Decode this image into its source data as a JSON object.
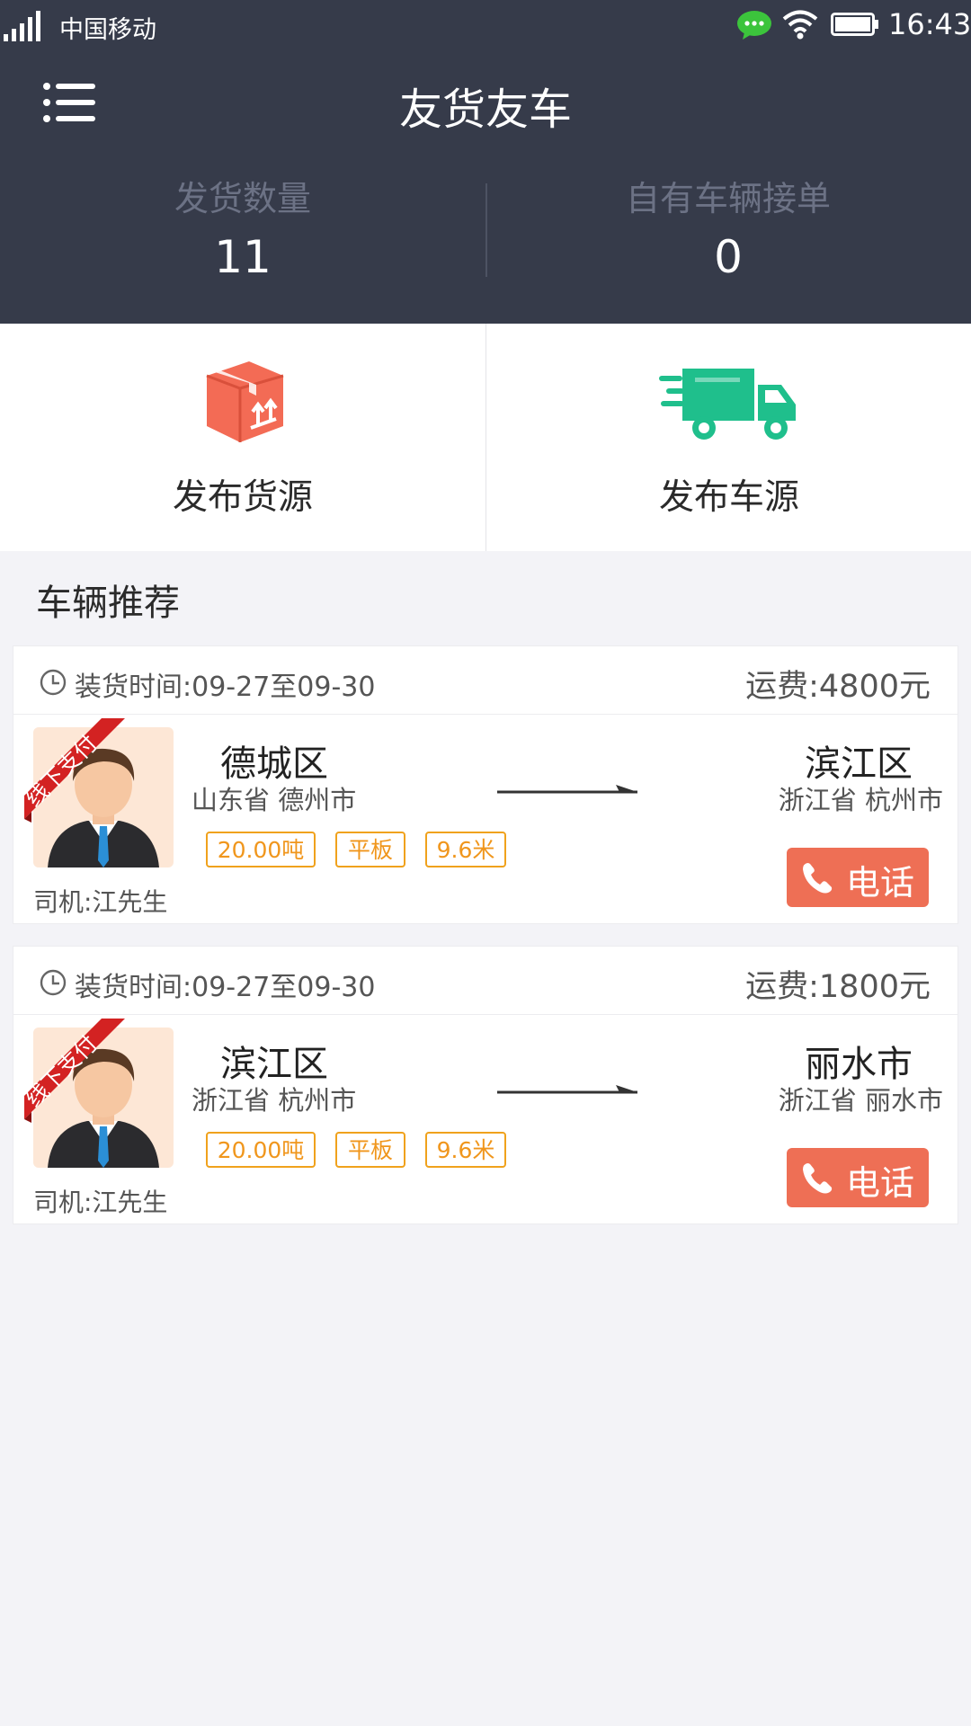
{
  "status_bar": {
    "carrier": "中国移动",
    "time": "16:43"
  },
  "header": {
    "title": "友货友车",
    "stats": [
      {
        "label": "发货数量",
        "value": "11"
      },
      {
        "label": "自有车辆接单",
        "value": "0"
      }
    ]
  },
  "actions": [
    {
      "label": "发布货源",
      "icon": "box-icon",
      "color": "#f36b55"
    },
    {
      "label": "发布车源",
      "icon": "truck-icon",
      "color": "#1fbf8c"
    }
  ],
  "section_title": "车辆推荐",
  "cards": [
    {
      "load_time": "装货时间:09-27至09-30",
      "fee": "运费:4800元",
      "badge": "线下支付",
      "from_city": "德城区",
      "from_province": "山东省 德州市",
      "to_city": "滨江区",
      "to_province": "浙江省 杭州市",
      "tags": [
        "20.00吨",
        "平板",
        "9.6米"
      ],
      "call_label": "电话",
      "driver": "司机:江先生"
    },
    {
      "load_time": "装货时间:09-27至09-30",
      "fee": "运费:1800元",
      "badge": "线下支付",
      "from_city": "滨江区",
      "from_province": "浙江省 杭州市",
      "to_city": "丽水市",
      "to_province": "浙江省 丽水市",
      "tags": [
        "20.00吨",
        "平板",
        "9.6米"
      ],
      "call_label": "电话",
      "driver": "司机:江先生"
    }
  ]
}
